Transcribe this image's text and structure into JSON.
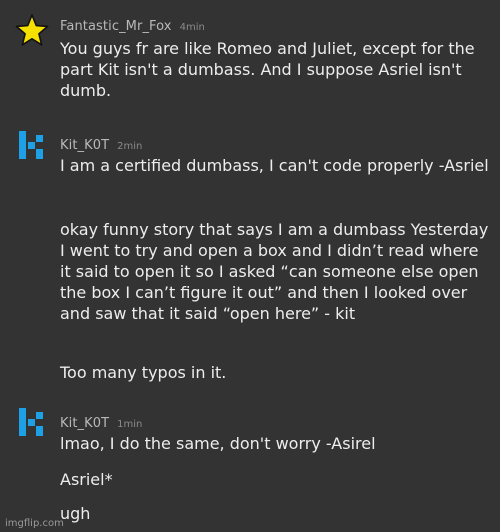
{
  "messages": [
    {
      "username": "Fantastic_Mr_Fox",
      "timestamp": "4min",
      "avatar_icon": "star-icon",
      "lines": [
        "You guys fr are like Romeo and Juliet, except for the part Kit isn't a dumbass. And I suppose Asriel isn't dumb."
      ]
    },
    {
      "username": "Kit_K0T",
      "timestamp": "2min",
      "avatar_icon": "k-logo-icon",
      "lines": [
        "I am a certified dumbass, I can't code properly -Asriel",
        "okay funny story that says I am a dumbass Yesterday I went to try and open a box and I didn’t read where it said to open it so I asked “can someone else open the box I can’t figure it out” and then I looked over and saw that it said “open here” - kit",
        "Too many typos in it."
      ]
    },
    {
      "username": "Kit_K0T",
      "timestamp": "1min",
      "avatar_icon": "k-logo-icon",
      "lines": [
        "lmao, I do the same, don't worry -Asirel",
        "Asriel*",
        "ugh"
      ]
    }
  ],
  "watermark": "imgflip.com",
  "colors": {
    "background": "#333333",
    "star_fill": "#f5e000",
    "k_logo": "#1ea0e6"
  }
}
